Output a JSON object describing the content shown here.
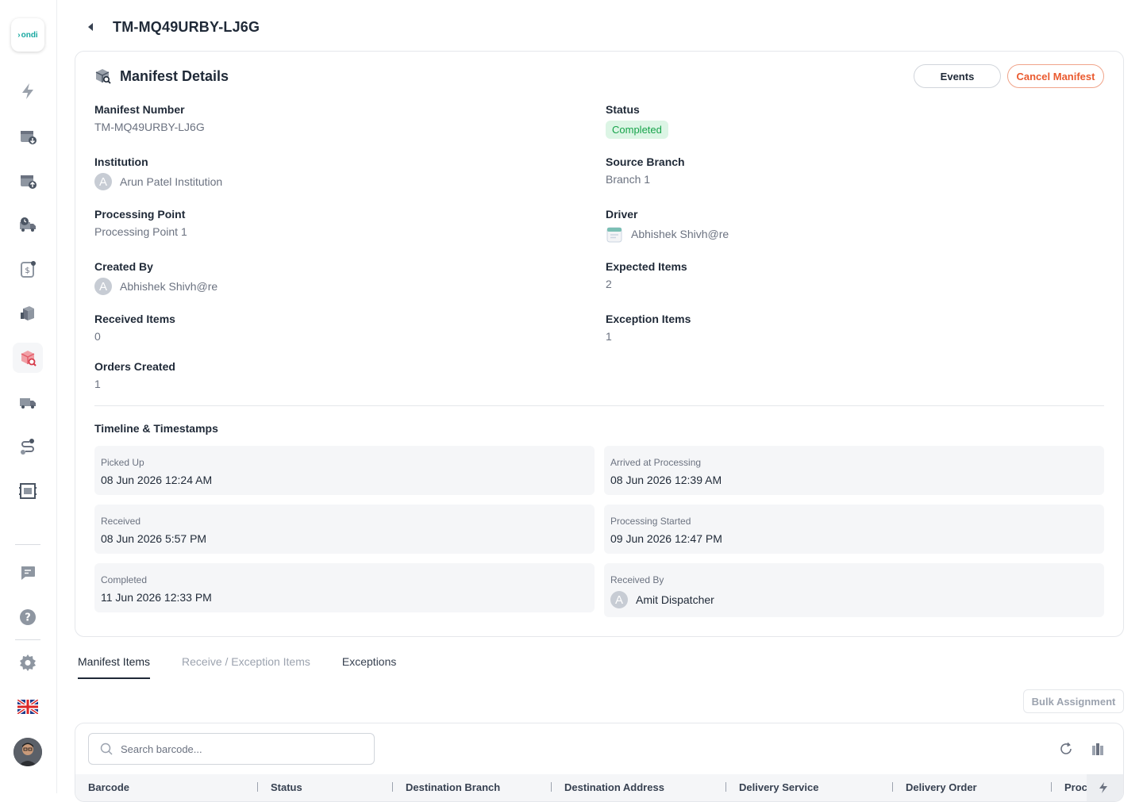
{
  "app": {
    "logo_text": "ondi"
  },
  "header": {
    "title": "TM-MQ49URBY-LJ6G"
  },
  "card": {
    "title": "Manifest Details",
    "events_label": "Events",
    "cancel_label": "Cancel Manifest",
    "fields": {
      "manifest_number": {
        "label": "Manifest Number",
        "value": "TM-MQ49URBY-LJ6G"
      },
      "status": {
        "label": "Status",
        "value": "Completed"
      },
      "institution": {
        "label": "Institution",
        "value": "Arun Patel Institution",
        "initial": "A"
      },
      "source_branch": {
        "label": "Source Branch",
        "value": "Branch 1"
      },
      "processing_point": {
        "label": "Processing Point",
        "value": "Processing Point 1"
      },
      "driver": {
        "label": "Driver",
        "value": "Abhishek Shivh@re"
      },
      "created_by": {
        "label": "Created By",
        "value": "Abhishek Shivh@re",
        "initial": "A"
      },
      "expected_items": {
        "label": "Expected Items",
        "value": "2"
      },
      "received_items": {
        "label": "Received Items",
        "value": "0"
      },
      "exception_items": {
        "label": "Exception Items",
        "value": "1"
      },
      "orders_created": {
        "label": "Orders Created",
        "value": "1"
      }
    },
    "timeline": {
      "title": "Timeline & Timestamps",
      "picked_up": {
        "label": "Picked Up",
        "value": "08 Jun 2026 12:24 AM"
      },
      "arrived_processing": {
        "label": "Arrived at Processing",
        "value": "08 Jun 2026 12:39 AM"
      },
      "received": {
        "label": "Received",
        "value": "08 Jun 2026 5:57 PM"
      },
      "processing_started": {
        "label": "Processing Started",
        "value": "09 Jun 2026 12:47 PM"
      },
      "completed": {
        "label": "Completed",
        "value": "11 Jun 2026 12:33 PM"
      },
      "received_by": {
        "label": "Received By",
        "value": "Amit Dispatcher",
        "initial": "A"
      }
    }
  },
  "tabs": [
    "Manifest Items",
    "Receive / Exception Items",
    "Exceptions"
  ],
  "bulk_label": "Bulk Assignment",
  "search": {
    "placeholder": "Search barcode..."
  },
  "table": {
    "columns": [
      "Barcode",
      "Status",
      "Destination Branch",
      "Destination Address",
      "Delivery Service",
      "Delivery Order",
      "Proc"
    ]
  },
  "colors": {
    "accent": "#ea5a2f",
    "success": "#16a34a",
    "brand": "#17a8a0"
  }
}
